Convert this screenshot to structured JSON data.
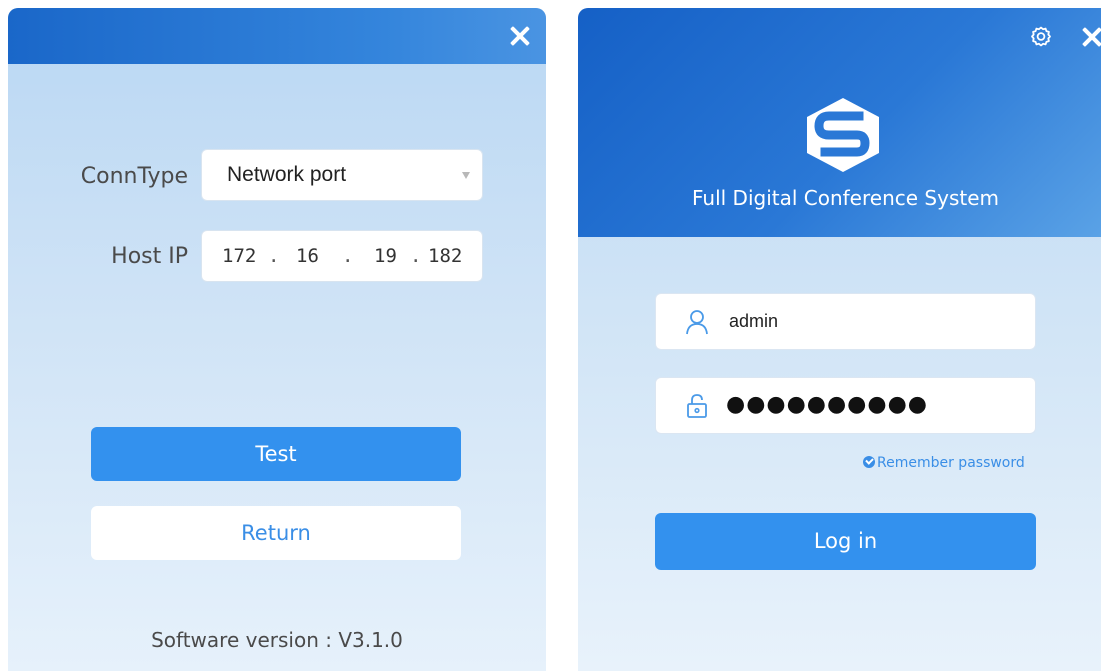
{
  "settings_window": {
    "conn_type_label": "ConnType",
    "conn_type_value": "Network port",
    "host_ip_label": "Host IP",
    "host_ip": [
      "172",
      "16",
      "19",
      "182"
    ],
    "ip_separator": ".",
    "test_label": "Test",
    "return_label": "Return",
    "version_text": "Software version : V3.1.0"
  },
  "login_window": {
    "app_title": "Full Digital Conference System",
    "username": "admin",
    "password_mask": "●●●●●●●●●●",
    "remember_label": "Remember password",
    "login_label": "Log in"
  },
  "icons": {
    "close": "close-icon",
    "settings": "gear-icon",
    "user": "user-icon",
    "lock": "lock-icon",
    "logo": "logo-icon",
    "dropdown": "chevron-down-icon",
    "check": "check-circle-icon"
  },
  "colors": {
    "accent": "#3391ee",
    "header_blue": "#1a67c9",
    "link_blue": "#3a8ee6"
  }
}
